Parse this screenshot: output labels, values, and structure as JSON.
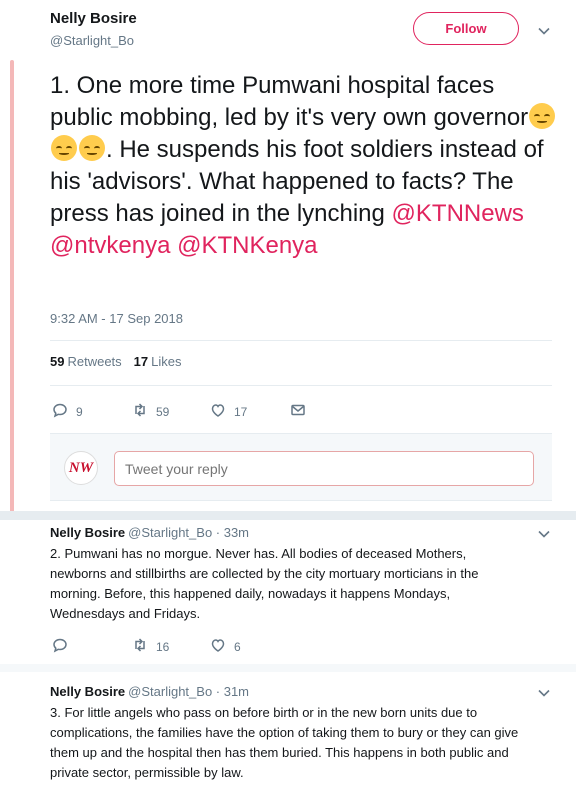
{
  "main_tweet": {
    "author_name": "Nelly Bosire",
    "author_handle": "@Starlight_Bo",
    "follow_label": "Follow",
    "text_before_emoji": "1. One more time Pumwani hospital faces public mobbing, led by it's very own governor",
    "emoji_name": "disappointed-face",
    "emoji_count": 3,
    "text_after_emoji": ". He suspends his foot soldiers instead of his 'advisors'. What happened to facts? The press has joined in the lynching ",
    "mentions": [
      "@KTNNews",
      "@ntvkenya",
      "@KTNKenya"
    ],
    "timestamp": "9:32 AM - 17 Sep 2018",
    "retweets_count": "59",
    "retweets_label": "Retweets",
    "likes_count": "17",
    "likes_label": "Likes",
    "actions": {
      "reply": "9",
      "retweet": "59",
      "like": "17"
    }
  },
  "reply_box": {
    "avatar_text": "NW",
    "placeholder": "Tweet your reply"
  },
  "replies": [
    {
      "author_name": "Nelly Bosire",
      "meta": "@Starlight_Bo · 33m",
      "text": "2. Pumwani has no morgue. Never has. All bodies of deceased Mothers, newborns and stillbirths are collected by the city mortuary morticians in the morning. Before, this happened daily, nowadays it happens Mondays, Wednesdays and Fridays.",
      "actions": {
        "reply": "",
        "retweet": "16",
        "like": "6"
      }
    },
    {
      "author_name": "Nelly Bosire",
      "meta": "@Starlight_Bo · 31m",
      "text": "3. For little angels who pass on before birth or in the new born units due to complications, the families have the option of taking them to bury or they can give them up and the hospital then has them buried. This happens in both public and private sector, permissible by law."
    }
  ],
  "colors": {
    "accent": "#e0245e",
    "thread_line": "#f4b8b8",
    "secondary_text": "#657786",
    "primary_text": "#14171a",
    "divider": "#e6ecf0"
  }
}
